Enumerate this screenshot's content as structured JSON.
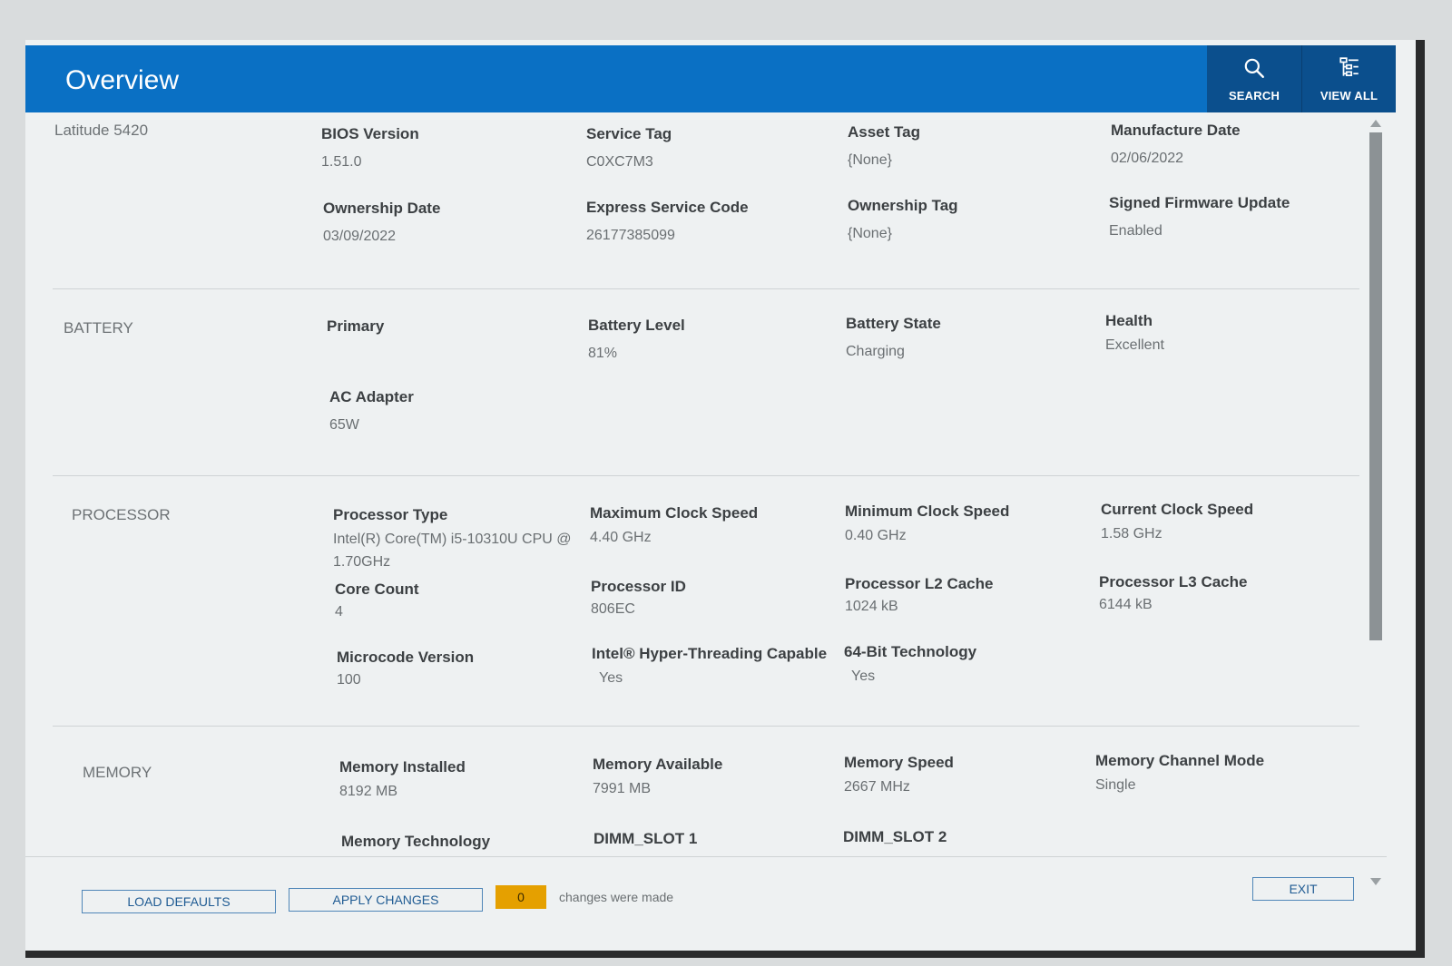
{
  "header": {
    "title": "Overview",
    "search_label": "SEARCH",
    "view_all_label": "VIEW ALL",
    "accent_color": "#0a70c4"
  },
  "system": {
    "model": "Latitude 5420",
    "fields": [
      {
        "label": "BIOS Version",
        "value": "1.51.0"
      },
      {
        "label": "Service Tag",
        "value": "C0XC7M3"
      },
      {
        "label": "Asset Tag",
        "value": "{None}"
      },
      {
        "label": "Manufacture Date",
        "value": "02/06/2022"
      },
      {
        "label": "Ownership Date",
        "value": "03/09/2022"
      },
      {
        "label": "Express Service Code",
        "value": "26177385099"
      },
      {
        "label": "Ownership Tag",
        "value": "{None}"
      },
      {
        "label": "Signed Firmware Update",
        "value": "Enabled"
      }
    ]
  },
  "battery": {
    "section_label": "BATTERY",
    "primary_label": "Primary",
    "fields": [
      {
        "label": "Battery Level",
        "value": "81%"
      },
      {
        "label": "Battery State",
        "value": "Charging"
      },
      {
        "label": "Health",
        "value": "Excellent"
      },
      {
        "label": "AC Adapter",
        "value": "65W"
      }
    ]
  },
  "processor": {
    "section_label": "PROCESSOR",
    "fields": [
      {
        "label": "Processor Type",
        "value": "Intel(R) Core(TM) i5-10310U CPU @ 1.70GHz"
      },
      {
        "label": "Maximum Clock Speed",
        "value": "4.40 GHz"
      },
      {
        "label": "Minimum Clock Speed",
        "value": "0.40 GHz"
      },
      {
        "label": "Current Clock Speed",
        "value": "1.58 GHz"
      },
      {
        "label": "Core Count",
        "value": "4"
      },
      {
        "label": "Processor ID",
        "value": "806EC"
      },
      {
        "label": "Processor L2 Cache",
        "value": "1024 kB"
      },
      {
        "label": "Processor L3 Cache",
        "value": "6144 kB"
      },
      {
        "label": "Microcode Version",
        "value": "100"
      },
      {
        "label": "Intel® Hyper-Threading Capable",
        "value": "Yes"
      },
      {
        "label": "64-Bit Technology",
        "value": "Yes"
      }
    ]
  },
  "memory": {
    "section_label": "MEMORY",
    "fields": [
      {
        "label": "Memory Installed",
        "value": "8192 MB"
      },
      {
        "label": "Memory Available",
        "value": "7991 MB"
      },
      {
        "label": "Memory Speed",
        "value": "2667 MHz"
      },
      {
        "label": "Memory Channel Mode",
        "value": "Single"
      },
      {
        "label": "Memory Technology",
        "value": ""
      },
      {
        "label": "DIMM_SLOT 1",
        "value": ""
      },
      {
        "label": "DIMM_SLOT 2",
        "value": ""
      }
    ]
  },
  "footer": {
    "load_defaults": "LOAD DEFAULTS",
    "apply_changes": "APPLY CHANGES",
    "changes_count": "0",
    "changes_text": "changes were made",
    "exit": "EXIT",
    "badge_color": "#e5a000"
  }
}
